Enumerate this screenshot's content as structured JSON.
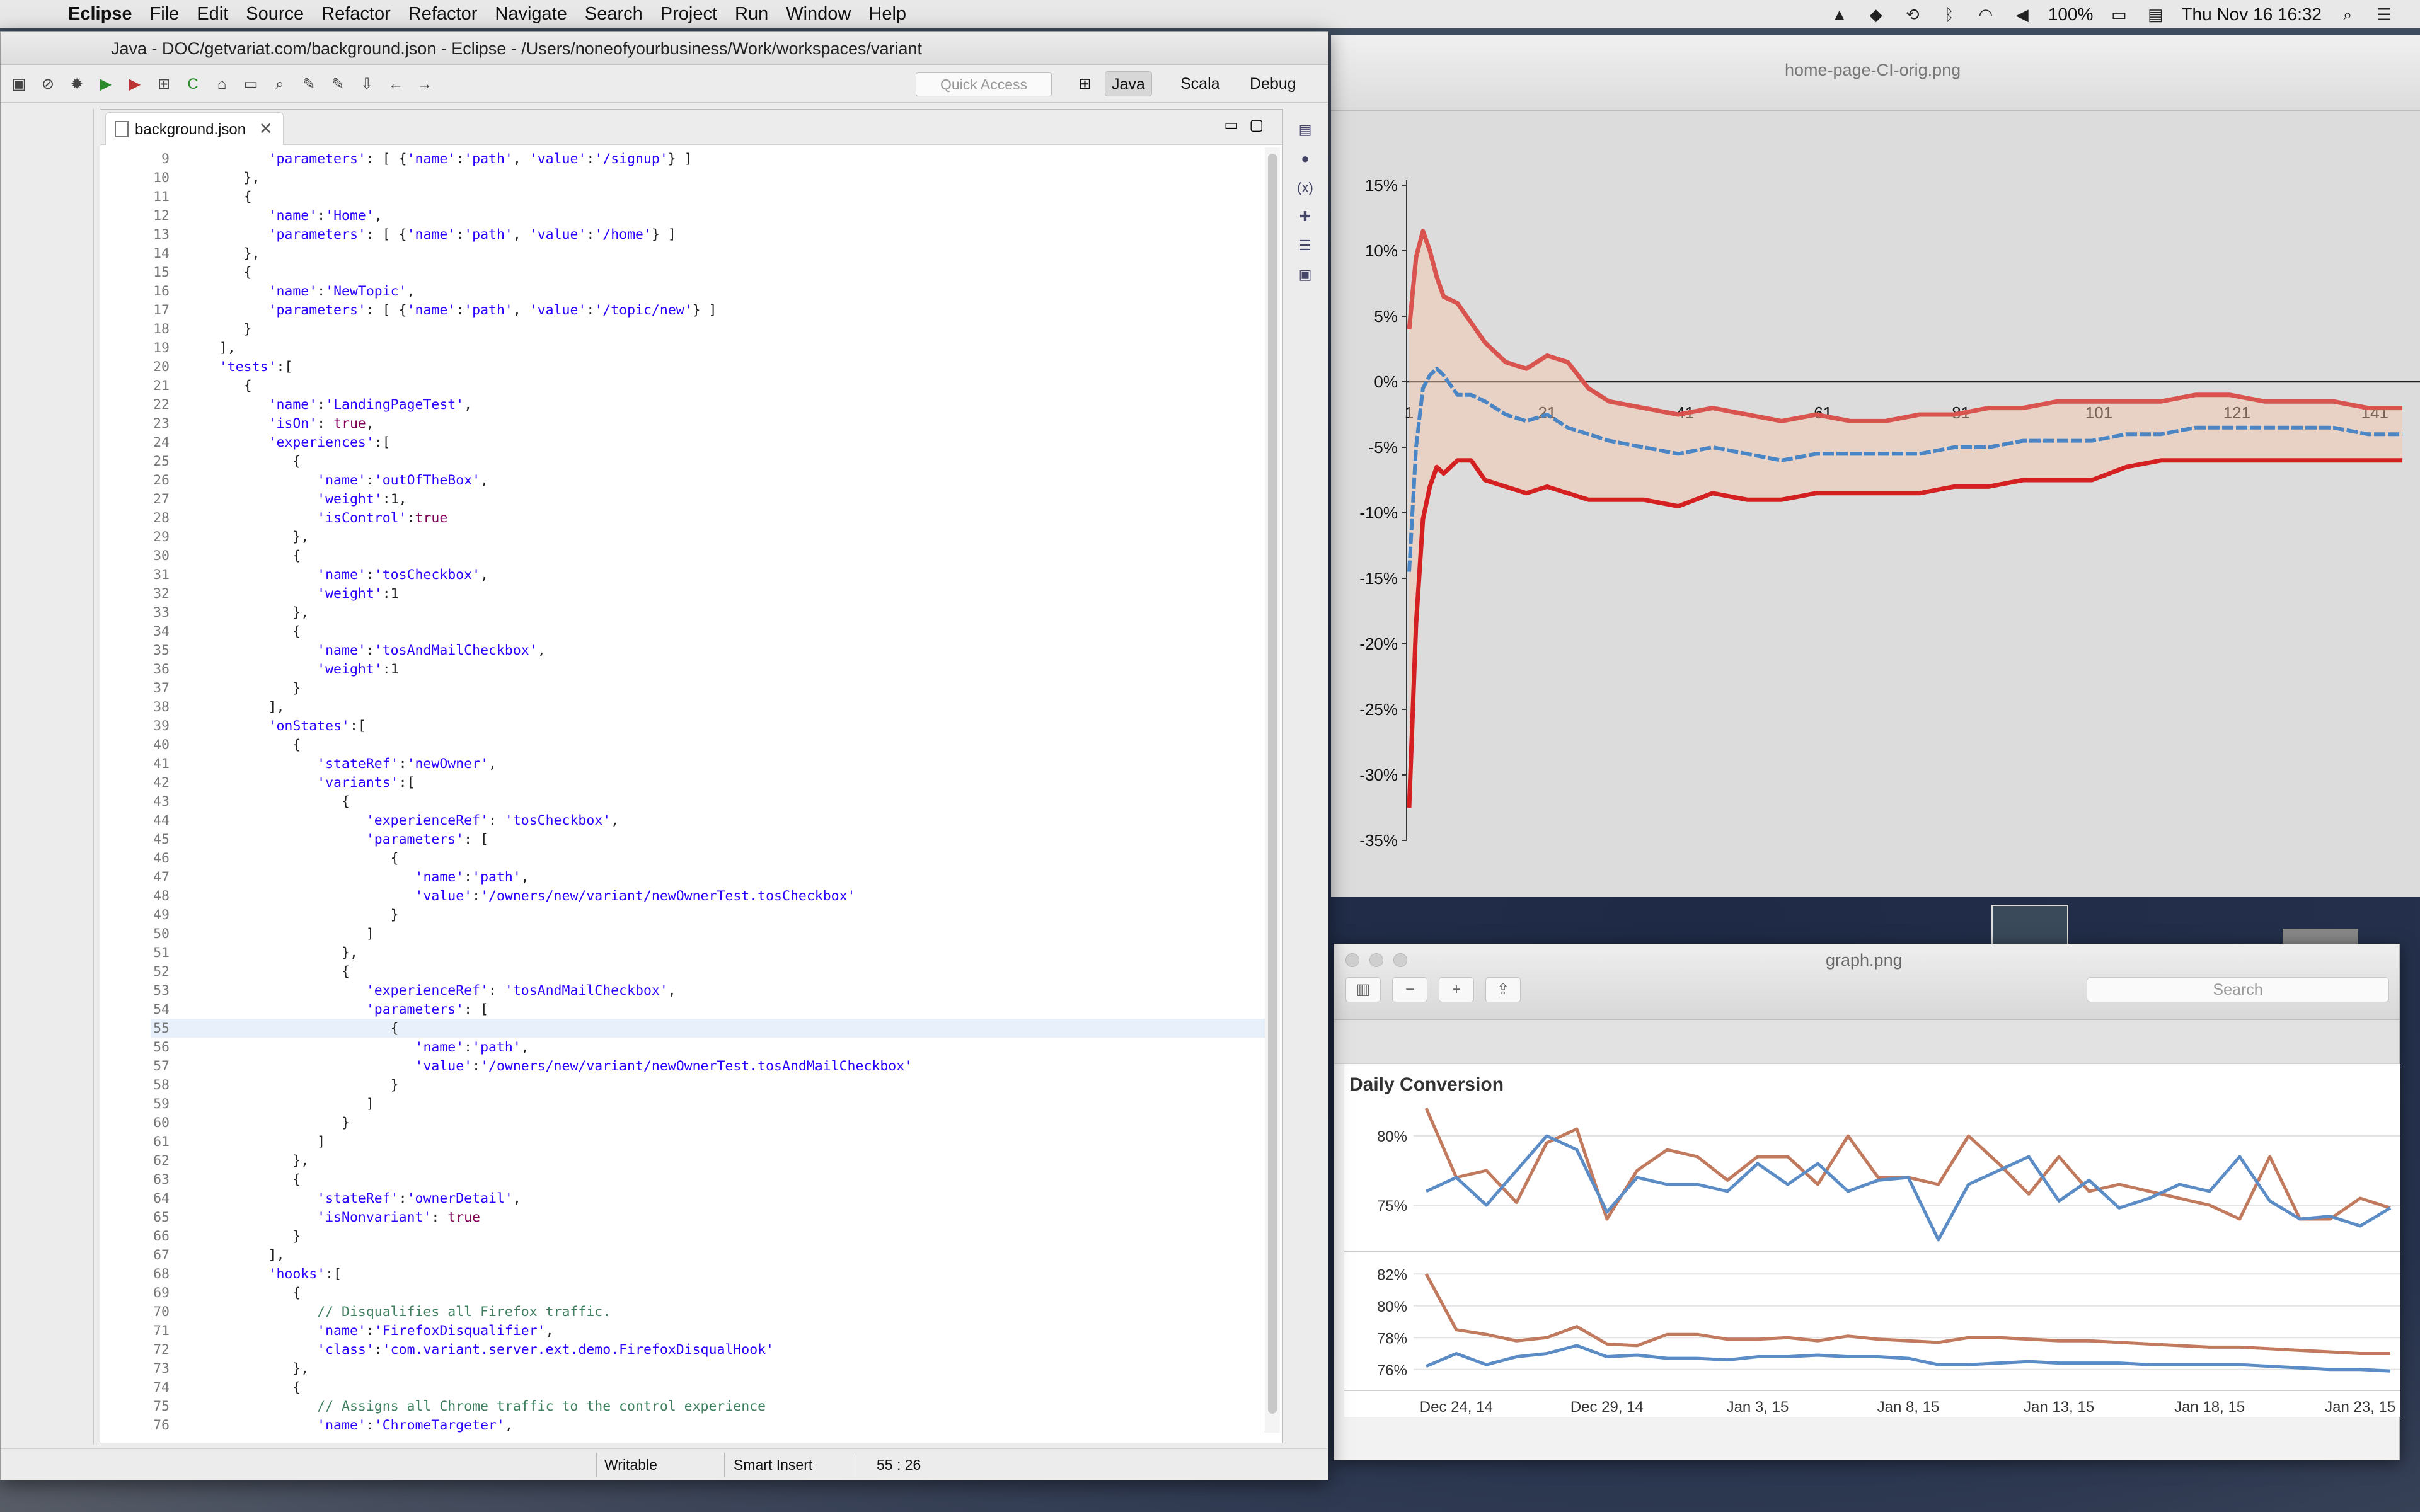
{
  "menubar": {
    "app": "Eclipse",
    "items": [
      "File",
      "Edit",
      "Source",
      "Refactor",
      "Refactor",
      "Navigate",
      "Search",
      "Project",
      "Run",
      "Window",
      "Help"
    ],
    "battery": "100%",
    "clock": "Thu Nov 16  16:32"
  },
  "eclipse": {
    "title": "Java - DOC/getvariat.com/background.json - Eclipse - /Users/noneofyourbusiness/Work/workspaces/variant",
    "quick_access": "Quick Access",
    "perspectives": [
      "Java",
      "Scala",
      "Debug"
    ],
    "tab_label": "background.json",
    "status": {
      "writable": "Writable",
      "insert": "Smart Insert",
      "position": "55 : 26"
    },
    "cursor_line": 55,
    "lines": [
      {
        "n": "9",
        "t": "         'parameters': [ {'name':'path', 'value':'/signup'} ]"
      },
      {
        "n": "10",
        "t": "      },"
      },
      {
        "n": "11",
        "t": "      {"
      },
      {
        "n": "12",
        "t": "         'name':'Home',"
      },
      {
        "n": "13",
        "t": "         'parameters': [ {'name':'path', 'value':'/home'} ]"
      },
      {
        "n": "14",
        "t": "      },"
      },
      {
        "n": "15",
        "t": "      {"
      },
      {
        "n": "16",
        "t": "         'name':'NewTopic',"
      },
      {
        "n": "17",
        "t": "         'parameters': [ {'name':'path', 'value':'/topic/new'} ]"
      },
      {
        "n": "18",
        "t": "      }"
      },
      {
        "n": "19",
        "t": "   ],"
      },
      {
        "n": "20",
        "t": "   'tests':["
      },
      {
        "n": "21",
        "t": "      {"
      },
      {
        "n": "22",
        "t": "         'name':'LandingPageTest',"
      },
      {
        "n": "23",
        "t": "         'isOn': true,"
      },
      {
        "n": "24",
        "t": "         'experiences':["
      },
      {
        "n": "25",
        "t": "            {"
      },
      {
        "n": "26",
        "t": "               'name':'outOfTheBox',"
      },
      {
        "n": "27",
        "t": "               'weight':1,"
      },
      {
        "n": "28",
        "t": "               'isControl':true"
      },
      {
        "n": "29",
        "t": "            },"
      },
      {
        "n": "30",
        "t": "            {"
      },
      {
        "n": "31",
        "t": "               'name':'tosCheckbox',"
      },
      {
        "n": "32",
        "t": "               'weight':1"
      },
      {
        "n": "33",
        "t": "            },"
      },
      {
        "n": "34",
        "t": "            {"
      },
      {
        "n": "35",
        "t": "               'name':'tosAndMailCheckbox',"
      },
      {
        "n": "36",
        "t": "               'weight':1"
      },
      {
        "n": "37",
        "t": "            }"
      },
      {
        "n": "38",
        "t": "         ],"
      },
      {
        "n": "39",
        "t": "         'onStates':["
      },
      {
        "n": "40",
        "t": "            {"
      },
      {
        "n": "41",
        "t": "               'stateRef':'newOwner',"
      },
      {
        "n": "42",
        "t": "               'variants':["
      },
      {
        "n": "43",
        "t": "                  {"
      },
      {
        "n": "44",
        "t": "                     'experienceRef': 'tosCheckbox',"
      },
      {
        "n": "45",
        "t": "                     'parameters': ["
      },
      {
        "n": "46",
        "t": "                        {"
      },
      {
        "n": "47",
        "t": "                           'name':'path',"
      },
      {
        "n": "48",
        "t": "                           'value':'/owners/new/variant/newOwnerTest.tosCheckbox'"
      },
      {
        "n": "49",
        "t": "                        }"
      },
      {
        "n": "50",
        "t": "                     ]"
      },
      {
        "n": "51",
        "t": "                  },"
      },
      {
        "n": "52",
        "t": "                  {"
      },
      {
        "n": "53",
        "t": "                     'experienceRef': 'tosAndMailCheckbox',"
      },
      {
        "n": "54",
        "t": "                     'parameters': ["
      },
      {
        "n": "55",
        "t": "                        {"
      },
      {
        "n": "56",
        "t": "                           'name':'path',"
      },
      {
        "n": "57",
        "t": "                           'value':'/owners/new/variant/newOwnerTest.tosAndMailCheckbox'"
      },
      {
        "n": "58",
        "t": "                        }"
      },
      {
        "n": "59",
        "t": "                     ]"
      },
      {
        "n": "60",
        "t": "                  }"
      },
      {
        "n": "61",
        "t": "               ]"
      },
      {
        "n": "62",
        "t": "            },"
      },
      {
        "n": "63",
        "t": "            {"
      },
      {
        "n": "64",
        "t": "               'stateRef':'ownerDetail',"
      },
      {
        "n": "65",
        "t": "               'isNonvariant': true"
      },
      {
        "n": "66",
        "t": "            }"
      },
      {
        "n": "67",
        "t": "         ],"
      },
      {
        "n": "68",
        "t": "         'hooks':["
      },
      {
        "n": "69",
        "t": "            {"
      },
      {
        "n": "70",
        "t": "               // Disqualifies all Firefox traffic."
      },
      {
        "n": "71",
        "t": "               'name':'FirefoxDisqualifier',"
      },
      {
        "n": "72",
        "t": "               'class':'com.variant.server.ext.demo.FirefoxDisqualHook'"
      },
      {
        "n": "73",
        "t": "            },"
      },
      {
        "n": "74",
        "t": "            {"
      },
      {
        "n": "75",
        "t": "               // Assigns all Chrome traffic to the control experience"
      },
      {
        "n": "76",
        "t": "               'name':'ChromeTargeter',"
      }
    ]
  },
  "preview1": {
    "filename": "home-page-CI-orig.png",
    "chart_data": {
      "type": "line",
      "ylim": [
        -35,
        15
      ],
      "yticks": [
        "15%",
        "10%",
        "5%",
        "0%",
        "-5%",
        "-10%",
        "-15%",
        "-20%",
        "-25%",
        "-30%",
        "-35%"
      ],
      "xticks": [
        "1",
        "21",
        "41",
        "61",
        "81",
        "101",
        "121",
        "141"
      ],
      "x": [
        1,
        2,
        3,
        4,
        5,
        6,
        8,
        10,
        12,
        15,
        18,
        21,
        24,
        27,
        30,
        35,
        40,
        45,
        50,
        55,
        60,
        65,
        70,
        75,
        80,
        85,
        90,
        95,
        100,
        105,
        110,
        115,
        120,
        125,
        130,
        135,
        140,
        145
      ],
      "series": [
        {
          "color": "#d9534f",
          "values": [
            4,
            9.5,
            11.5,
            10,
            8,
            6.5,
            6,
            4.5,
            3,
            1.5,
            1,
            2,
            1.5,
            -0.5,
            -1.5,
            -2,
            -2.5,
            -2,
            -2.5,
            -3,
            -2.5,
            -3,
            -3,
            -2.5,
            -2.5,
            -2,
            -2,
            -1.5,
            -1.5,
            -1.5,
            -1.5,
            -1,
            -1,
            -1.5,
            -1.5,
            -1.5,
            -2,
            -2
          ]
        },
        {
          "color": "#4a86c5",
          "values": [
            -14.5,
            -5,
            -0.5,
            0.5,
            1,
            0.5,
            -1,
            -1,
            -1.5,
            -2.5,
            -3,
            -2.5,
            -3.5,
            -4,
            -4.5,
            -5,
            -5.5,
            -5,
            -5.5,
            -6,
            -5.5,
            -5.5,
            -5.5,
            -5.5,
            -5,
            -5,
            -4.5,
            -4.5,
            -4.5,
            -4,
            -4,
            -3.5,
            -3.5,
            -3.5,
            -3.5,
            -3.5,
            -4,
            -4
          ]
        },
        {
          "color": "#d42020",
          "values": [
            -32.5,
            -18.5,
            -10.5,
            -8,
            -6.5,
            -7,
            -6,
            -6,
            -7.5,
            -8,
            -8.5,
            -8,
            -8.5,
            -9,
            -9,
            -9,
            -9.5,
            -8.5,
            -9,
            -9,
            -8.5,
            -8.5,
            -8.5,
            -8.5,
            -8,
            -8,
            -7.5,
            -7.5,
            -7.5,
            -6.5,
            -6,
            -6,
            -6,
            -6,
            -6,
            -6,
            -6,
            -6
          ]
        }
      ]
    }
  },
  "preview2": {
    "filename": "graph.png",
    "search_placeholder": "Search",
    "chart_data": {
      "type": "line",
      "title": "Daily Conversion",
      "top_yticks": [
        "80%",
        "75%"
      ],
      "top_ylim": [
        72,
        82
      ],
      "bottom_yticks": [
        "82%",
        "80%",
        "78%",
        "76%"
      ],
      "bottom_ylim": [
        75,
        83
      ],
      "xticks": [
        "Dec 24, 14",
        "Dec 29, 14",
        "Jan 3, 15",
        "Jan 8, 15",
        "Jan 13, 15",
        "Jan 18, 15",
        "Jan 23, 15"
      ],
      "top_series": [
        {
          "color": "#c17a5e",
          "values": [
            82,
            77,
            77.5,
            75.2,
            79.5,
            80.5,
            74,
            77.5,
            79,
            78.5,
            76.8,
            78.5,
            78.5,
            76.5,
            80,
            77,
            77,
            76.5,
            80,
            78,
            75.8,
            78.5,
            76,
            76.5,
            76,
            75.5,
            75,
            74,
            78.5,
            74,
            74,
            75.5,
            74.8
          ]
        },
        {
          "color": "#5b8cc6",
          "values": [
            76,
            77,
            75,
            77.5,
            80,
            79,
            74.5,
            77,
            76.5,
            76.5,
            76,
            78,
            76.5,
            78,
            76,
            76.8,
            77,
            72.5,
            76.5,
            77.5,
            78.5,
            75.3,
            76.8,
            74.8,
            75.5,
            76.5,
            76,
            78.5,
            75.3,
            74,
            74.2,
            73.5,
            74.8
          ]
        }
      ],
      "bottom_series": [
        {
          "color": "#c17a5e",
          "values": [
            82,
            78.5,
            78.2,
            77.8,
            78,
            78.7,
            77.6,
            77.5,
            78.2,
            78.2,
            77.9,
            77.9,
            78,
            77.8,
            78.1,
            77.9,
            77.8,
            77.7,
            78,
            78,
            77.9,
            77.8,
            77.8,
            77.7,
            77.6,
            77.5,
            77.4,
            77.4,
            77.3,
            77.2,
            77.1,
            77,
            77
          ]
        },
        {
          "color": "#5b8cc6",
          "values": [
            76.2,
            77,
            76.3,
            76.8,
            77,
            77.5,
            76.8,
            76.9,
            76.7,
            76.7,
            76.6,
            76.8,
            76.8,
            76.9,
            76.8,
            76.8,
            76.7,
            76.3,
            76.3,
            76.4,
            76.5,
            76.4,
            76.4,
            76.4,
            76.3,
            76.3,
            76.3,
            76.3,
            76.2,
            76.1,
            76,
            76,
            75.9
          ]
        }
      ]
    }
  }
}
